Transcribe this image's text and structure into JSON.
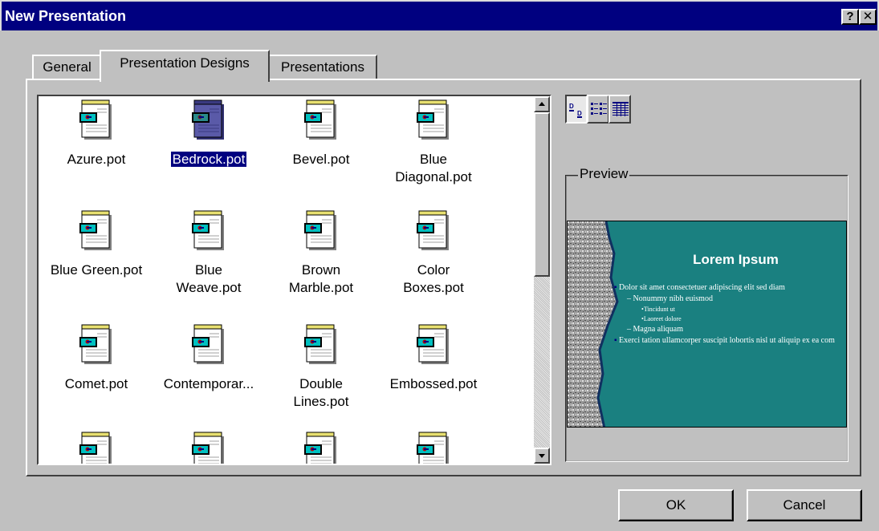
{
  "window": {
    "title": "New Presentation",
    "help_label": "?",
    "close_label": "✕"
  },
  "tabs": [
    {
      "label": "General"
    },
    {
      "label": "Presentation Designs",
      "selected": true
    },
    {
      "label": "Presentations"
    }
  ],
  "files": [
    {
      "line1": "Azure.pot",
      "line2": "",
      "icon": "template-file-icon"
    },
    {
      "line1": "Bedrock.pot",
      "line2": "",
      "icon": "template-file-icon",
      "selected": true
    },
    {
      "line1": "Bevel.pot",
      "line2": "",
      "icon": "template-file-icon"
    },
    {
      "line1": "Blue",
      "line2": "Diagonal.pot",
      "icon": "template-file-icon"
    },
    {
      "line1": "Blue Green.pot",
      "line2": "",
      "icon": "template-file-icon"
    },
    {
      "line1": "Blue",
      "line2": "Weave.pot",
      "icon": "template-file-icon"
    },
    {
      "line1": "Brown",
      "line2": "Marble.pot",
      "icon": "template-file-icon"
    },
    {
      "line1": "Color",
      "line2": "Boxes.pot",
      "icon": "template-file-icon"
    },
    {
      "line1": "Comet.pot",
      "line2": "",
      "icon": "template-file-icon"
    },
    {
      "line1": "Contemporar...",
      "line2": "",
      "icon": "template-file-icon"
    },
    {
      "line1": "Double",
      "line2": "Lines.pot",
      "icon": "template-file-icon"
    },
    {
      "line1": "Embossed.pot",
      "line2": "",
      "icon": "template-file-icon"
    },
    {
      "line1": "",
      "line2": "",
      "icon": "template-file-icon"
    },
    {
      "line1": "",
      "line2": "",
      "icon": "template-file-icon"
    },
    {
      "line1": "",
      "line2": "",
      "icon": "template-file-icon"
    },
    {
      "line1": "",
      "line2": "",
      "icon": "template-file-icon"
    }
  ],
  "view_buttons": [
    {
      "icon": "large-icons-view-icon",
      "active": true
    },
    {
      "icon": "list-view-icon"
    },
    {
      "icon": "details-view-icon"
    }
  ],
  "preview": {
    "group_label": "Preview",
    "slide_title": "Lorem Ipsum",
    "bullets": [
      {
        "level": 1,
        "text": "Dolor sit amet consectetuer adipiscing elit sed diam"
      },
      {
        "level": 2,
        "text": "– Nonummy nibh euismod"
      },
      {
        "level": 3,
        "text": "Tincidunt ut"
      },
      {
        "level": 3,
        "text": "Laoreet dolore"
      },
      {
        "level": 2,
        "text": "– Magna aliquam"
      },
      {
        "level": 1,
        "text": "Exerci tation ullamcorper suscipit lobortis nisl ut aliquip ex ea com"
      }
    ]
  },
  "buttons": {
    "ok": "OK",
    "cancel": "Cancel"
  },
  "colors": {
    "titlebar": "#000080",
    "face": "#c0c0c0",
    "slide_bg": "#1a8080",
    "selection": "#000080"
  }
}
